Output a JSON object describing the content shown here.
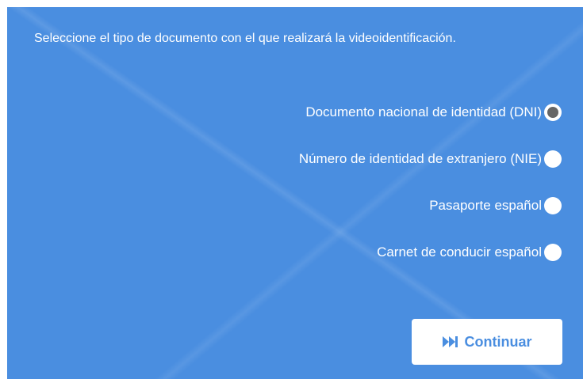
{
  "instruction": "Seleccione el tipo de documento con el que realizará la videoidentificación.",
  "options": [
    {
      "label": "Documento nacional de identidad (DNI)",
      "selected": true
    },
    {
      "label": "Número de identidad de extranjero (NIE)",
      "selected": false
    },
    {
      "label": "Pasaporte español",
      "selected": false
    },
    {
      "label": "Carnet de conducir español",
      "selected": false
    }
  ],
  "continue_button": {
    "label": "Continuar",
    "icon": "skip-forward-icon"
  },
  "colors": {
    "panel_background": "#4a8ee0",
    "text": "#ffffff",
    "radio_selected_dot": "#666666",
    "button_background": "#ffffff",
    "button_text": "#4a8ee0"
  }
}
